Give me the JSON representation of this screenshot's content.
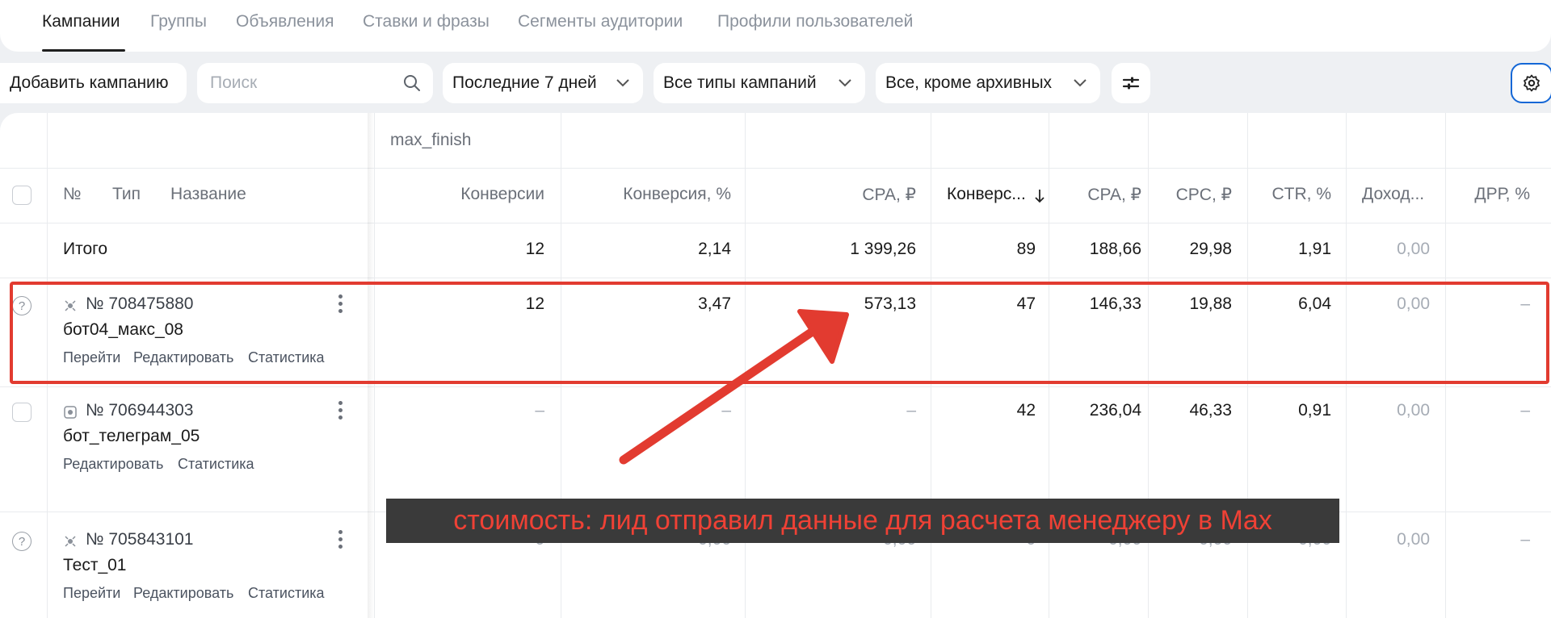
{
  "tabs": [
    "Кампании",
    "Группы",
    "Объявления",
    "Ставки и фразы",
    "Сегменты аудитории",
    "Профили пользователей"
  ],
  "toolbar": {
    "add_campaign": "Добавить кампанию",
    "search_placeholder": "Поиск",
    "period": "Последние 7 дней",
    "campaign_types": "Все типы кампаний",
    "archive_filter": "Все, кроме архивных"
  },
  "table": {
    "group_header": "max_finish",
    "headers": {
      "num": "№",
      "type": "Тип",
      "name": "Название",
      "conversions": "Конверсии",
      "conversion_pct": "Конверсия, %",
      "cpa": "CPA, ₽",
      "conversions_sorted": "Конверс...",
      "cpa2": "CPA, ₽",
      "cpc": "CPC, ₽",
      "ctr": "CTR, %",
      "income": "Доход...",
      "drr": "ДРР, %"
    },
    "totals": {
      "label": "Итого",
      "conversions": "12",
      "conversion_pct": "2,14",
      "cpa": "1 399,26",
      "conversions_sorted": "89",
      "cpa2": "188,66",
      "cpc": "29,98",
      "ctr": "1,91",
      "income": "0,00",
      "drr": ""
    },
    "rows": [
      {
        "id": "№ 708475880",
        "name": "бот04_макс_08",
        "actions": [
          "Перейти",
          "Редактировать",
          "Статистика"
        ],
        "conversions": "12",
        "conversion_pct": "3,47",
        "cpa": "573,13",
        "conversions_sorted": "47",
        "cpa2": "146,33",
        "cpc": "19,88",
        "ctr": "6,04",
        "income": "0,00",
        "drr": "–"
      },
      {
        "id": "№ 706944303",
        "name": "бот_телеграм_05",
        "actions": [
          "Редактировать",
          "Статистика"
        ],
        "conversions": "–",
        "conversion_pct": "–",
        "cpa": "–",
        "conversions_sorted": "42",
        "cpa2": "236,04",
        "cpc": "46,33",
        "ctr": "0,91",
        "income": "0,00",
        "drr": "–"
      },
      {
        "id": "№ 705843101",
        "name": "Тест_01",
        "actions": [
          "Перейти",
          "Редактировать",
          "Статистика"
        ],
        "conversions": "0",
        "conversion_pct": "0,00",
        "cpa": "0,00",
        "conversions_sorted": "0",
        "cpa2": "0,00",
        "cpc": "0,00",
        "ctr": "0,00",
        "income": "0,00",
        "drr": "–"
      }
    ]
  },
  "annotation": {
    "caption": "стоимость: лид отправил данные для расчета менеджеру в Max",
    "color": "#e23b30"
  }
}
